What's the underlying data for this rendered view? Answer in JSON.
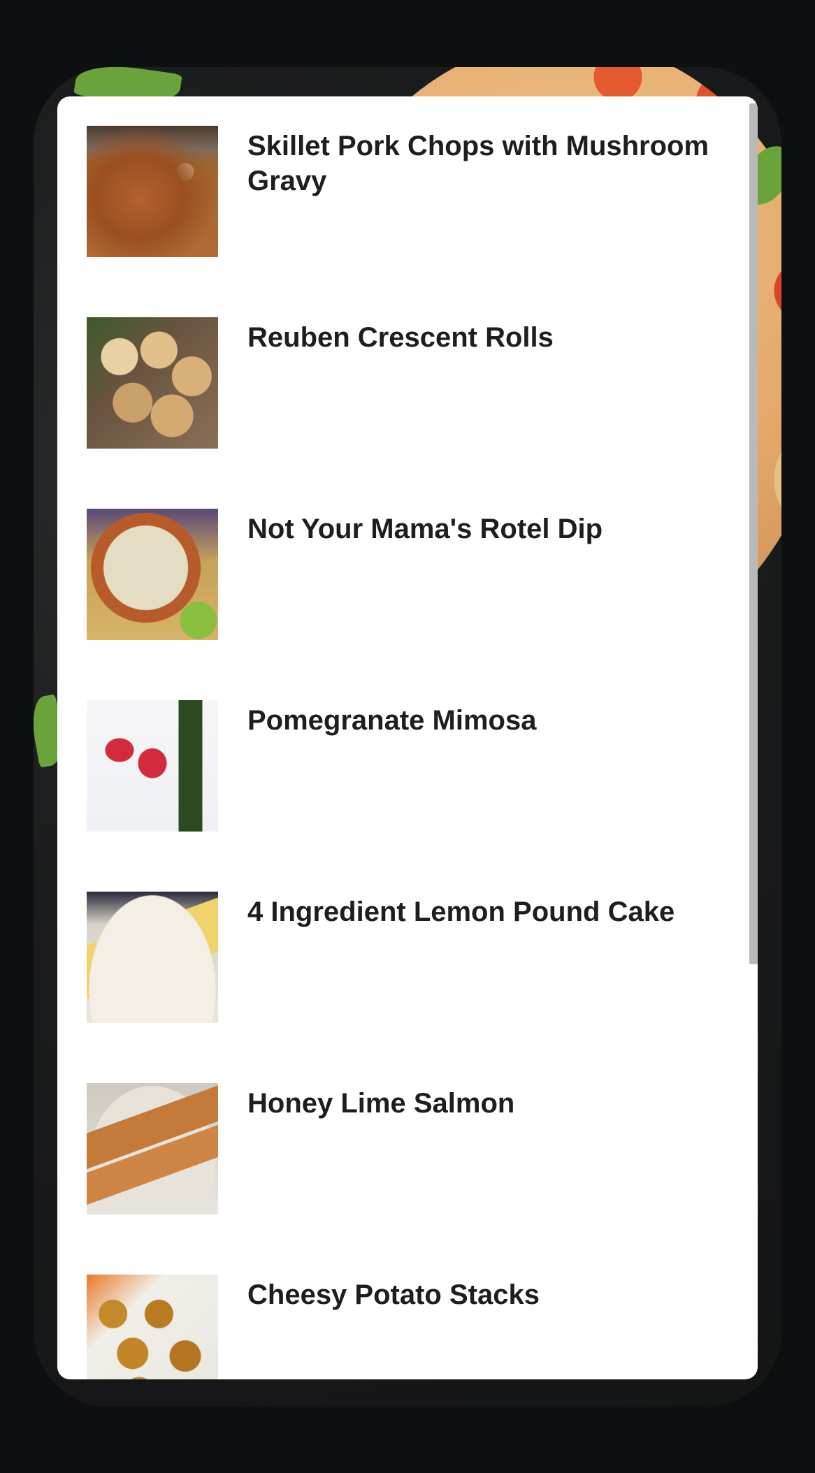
{
  "recipes": [
    {
      "title": "Skillet Pork Chops with Mushroom Gravy",
      "image_icon": "pork-chops-photo"
    },
    {
      "title": "Reuben Crescent Rolls",
      "image_icon": "crescent-rolls-photo"
    },
    {
      "title": "Not Your Mama's Rotel Dip",
      "image_icon": "rotel-dip-photo"
    },
    {
      "title": "Pomegranate Mimosa",
      "image_icon": "mimosa-photo"
    },
    {
      "title": "4 Ingredient Lemon Pound Cake",
      "image_icon": "lemon-cake-photo"
    },
    {
      "title": "Honey Lime Salmon",
      "image_icon": "salmon-photo"
    },
    {
      "title": "Cheesy Potato Stacks",
      "image_icon": "potato-stacks-photo"
    }
  ],
  "colors": {
    "background": "#0d0f10",
    "card": "#ffffff",
    "title_text": "#1e1e1e",
    "scrollbar": "#b9b9b9"
  }
}
